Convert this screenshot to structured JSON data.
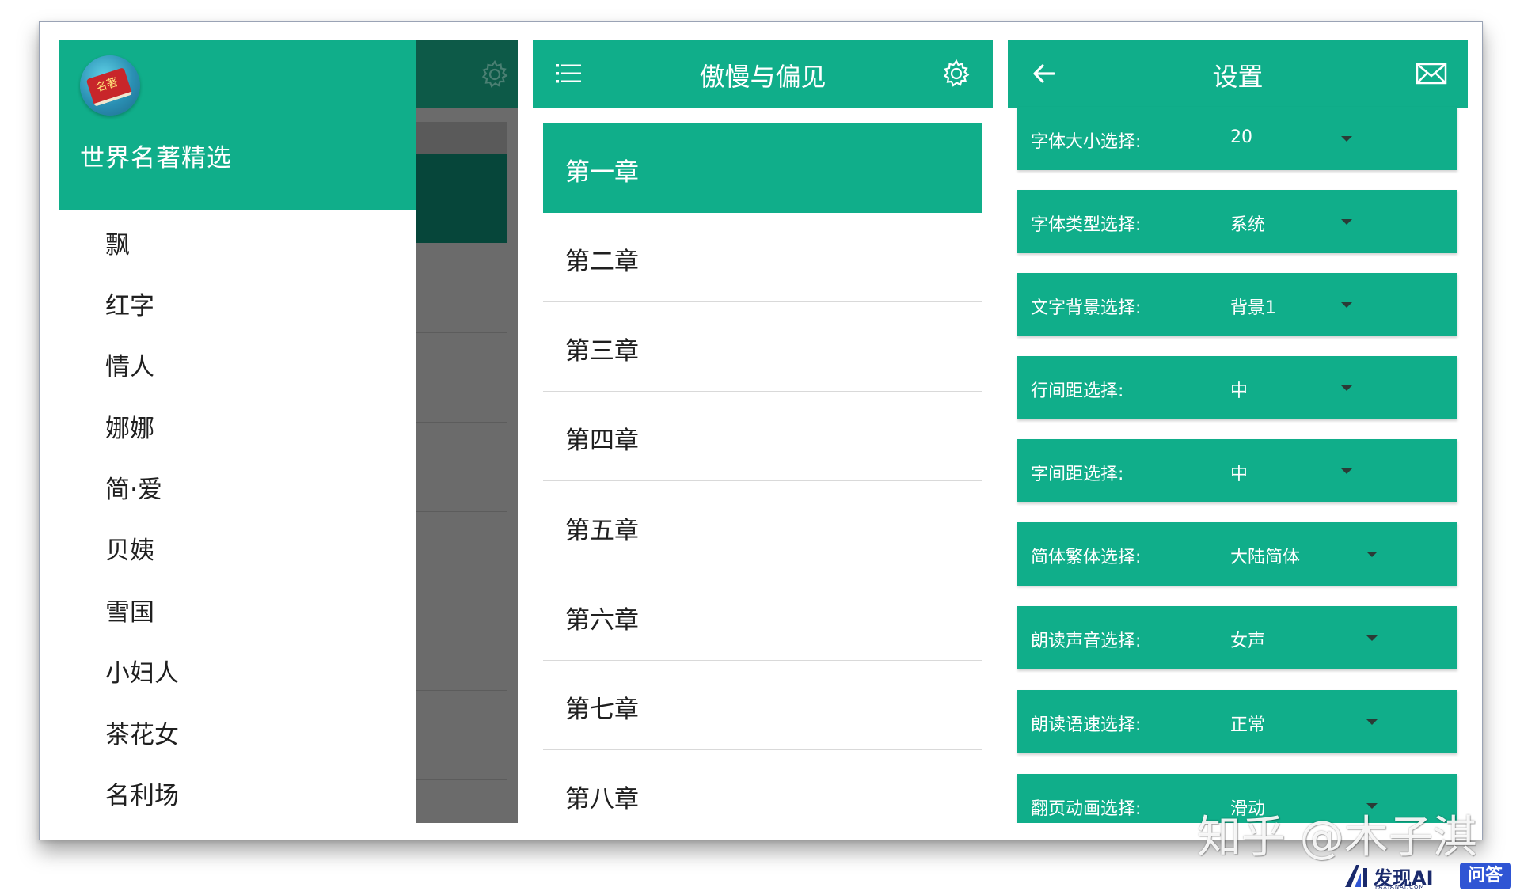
{
  "colors": {
    "accent": "#10ae8a",
    "scrim": "#6b6b6b",
    "text": "#1f1f1f"
  },
  "drawer": {
    "app_title": "世界名著精选",
    "logo_text": "名著",
    "books": [
      "飘",
      "红字",
      "情人",
      "娜娜",
      "简·爱",
      "贝姨",
      "雪国",
      "小妇人",
      "茶花女",
      "名利场"
    ]
  },
  "chapters": {
    "title": "傲慢与偏见",
    "items": [
      "第一章",
      "第二章",
      "第三章",
      "第四章",
      "第五章",
      "第六章",
      "第七章",
      "第八章"
    ],
    "selected": 0
  },
  "settings": {
    "title": "设置",
    "items": [
      {
        "label": "字体大小选择:",
        "value": "20"
      },
      {
        "label": "字体类型选择:",
        "value": "系统"
      },
      {
        "label": "文字背景选择:",
        "value": "背景1"
      },
      {
        "label": "行间距选择:",
        "value": "中"
      },
      {
        "label": "字间距选择:",
        "value": "中"
      },
      {
        "label": "简体繁体选择:",
        "value": "大陆简体"
      },
      {
        "label": "朗读声音选择:",
        "value": "女声"
      },
      {
        "label": "朗读语速选择:",
        "value": "正常"
      },
      {
        "label": "翻页动画选择:",
        "value": "滑动"
      }
    ]
  },
  "icons": {
    "drawer_logo": "book-logo-icon",
    "menu": "menu-icon",
    "settings": "gear-icon",
    "back": "arrow-left-icon",
    "feedback": "mail-icon"
  },
  "watermarks": {
    "zhihu": "知乎 @木子淇",
    "faxian_name": "发现AI",
    "faxian_sub": "FAXIANAI.COM",
    "faxian_qa": "问答"
  }
}
